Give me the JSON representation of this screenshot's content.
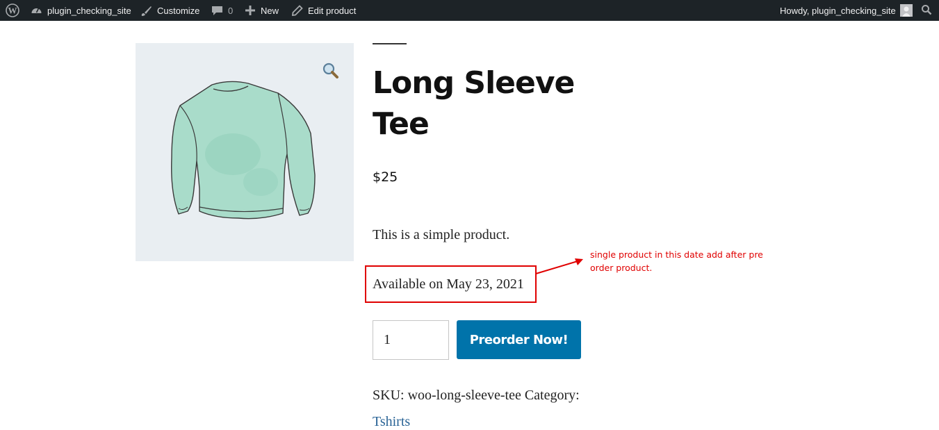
{
  "admin_bar": {
    "site_name": "plugin_checking_site",
    "customize_label": "Customize",
    "comments_count": "0",
    "new_label": "New",
    "edit_label": "Edit product",
    "greeting": "Howdy, plugin_checking_site",
    "icons": [
      "wordpress-logo-icon",
      "dashboard-icon",
      "brush-icon",
      "comment-icon",
      "plus-icon",
      "pencil-icon",
      "avatar-icon",
      "search-icon"
    ],
    "background_color": "#1d2327"
  },
  "product": {
    "title": "Long Sleeve Tee",
    "price": "$25",
    "description": "This is a simple product.",
    "availability": "Available on May 23, 2021",
    "quantity": "1",
    "button_label": "Preorder Now!",
    "meta_text": "SKU: woo-long-sleeve-tee Category:",
    "category": "Tshirts",
    "image_icon": "long-sleeve-tee-image",
    "button_color": "#0073aa"
  },
  "annotation": {
    "note": "single product in this date add after pre order product.",
    "color": "#e00000"
  }
}
